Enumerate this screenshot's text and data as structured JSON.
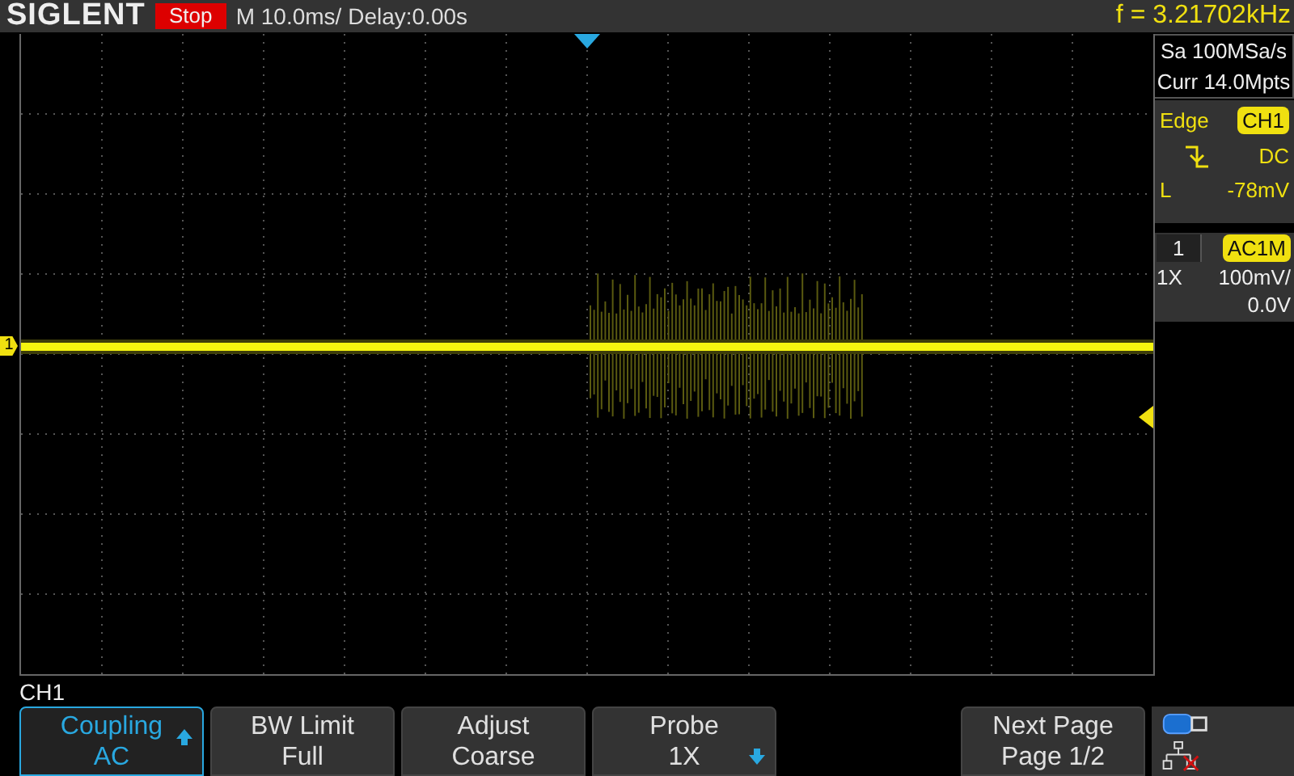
{
  "header": {
    "brand": "SIGLENT",
    "run_state": "Stop",
    "timebase": "M 10.0ms/ Delay:0.00s",
    "frequency": "f = 3.21702kHz"
  },
  "acquisition": {
    "sample_rate": "Sa 100MSa/s",
    "memory": "Curr 14.0Mpts"
  },
  "trigger": {
    "type": "Edge",
    "source": "CH1",
    "coupling": "DC",
    "level_prefix": "L",
    "level_reading": "-78mV"
  },
  "channel": {
    "number": "1",
    "coupling": "AC1M",
    "probe": "1X",
    "scale": "100mV/",
    "offset": "0.0V",
    "marker": "1"
  },
  "menu": {
    "title": "CH1",
    "buttons": [
      {
        "label": "Coupling",
        "value": "AC",
        "selected": true,
        "arrow_up": true,
        "arrow_down": false
      },
      {
        "label": "BW Limit",
        "value": "Full",
        "selected": false,
        "arrow_up": false,
        "arrow_down": false
      },
      {
        "label": "Adjust",
        "value": "Coarse",
        "selected": false,
        "arrow_up": false,
        "arrow_down": false
      },
      {
        "label": "Probe",
        "value": "1X",
        "selected": false,
        "arrow_up": false,
        "arrow_down": true
      }
    ],
    "next_page": {
      "label": "Next Page",
      "value": "Page 1/2"
    }
  }
}
